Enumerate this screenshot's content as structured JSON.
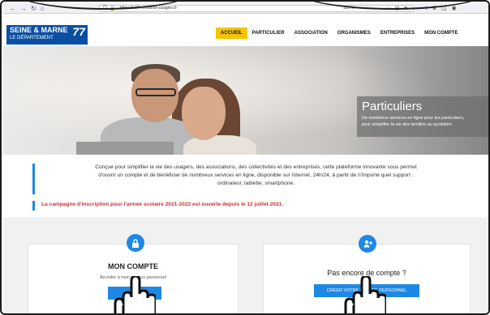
{
  "browser": {
    "url": "https://cel7.../relation-usagers.fr",
    "zoom": "133 %",
    "menu_dots": "···"
  },
  "logo": {
    "main": "SEINE & MARNE",
    "sub": "LE DÉPARTEMENT",
    "number": "77"
  },
  "nav": {
    "items": [
      "ACCUEIL",
      "PARTICULIER",
      "ASSOCIATION",
      "ORGANISMES",
      "ENTREPRISES",
      "MON COMPTE"
    ]
  },
  "hero": {
    "title": "Particuliers",
    "subtitle_1": "De nombreux services en ligne pour les particuliers,",
    "subtitle_2": "pour simplifier la vie des familles au quotidien"
  },
  "intro": {
    "line_1": "Conçue pour simplifier la vie des usagers, des associations, des collectivités et des entreprises, cette plateforme innovante vous permet",
    "line_2": "d'ouvrir un compte et de bénéficier de nombreux services en ligne, disponible sur Internet, 24h/24, à partir de n'importe quel support :",
    "line_3": "ordinateur, tablette, smartphone."
  },
  "campaign": {
    "text": "La campagne d'inscription pour l'année scolaire 2021-2022 est ouverte depuis le 12 juillet 2021."
  },
  "card_account": {
    "title": "MON COMPTE",
    "description": "Accéder à mon espace personnel",
    "button": ""
  },
  "card_signup": {
    "title": "Pas encore de compte ?",
    "button": "CRÉER VOTRE ESPACE PERSONNEL"
  },
  "colors": {
    "accent": "#1e88e5",
    "nav_active": "#f5c400",
    "campaign": "#d32f2f",
    "brand": "#0a4fa3"
  }
}
